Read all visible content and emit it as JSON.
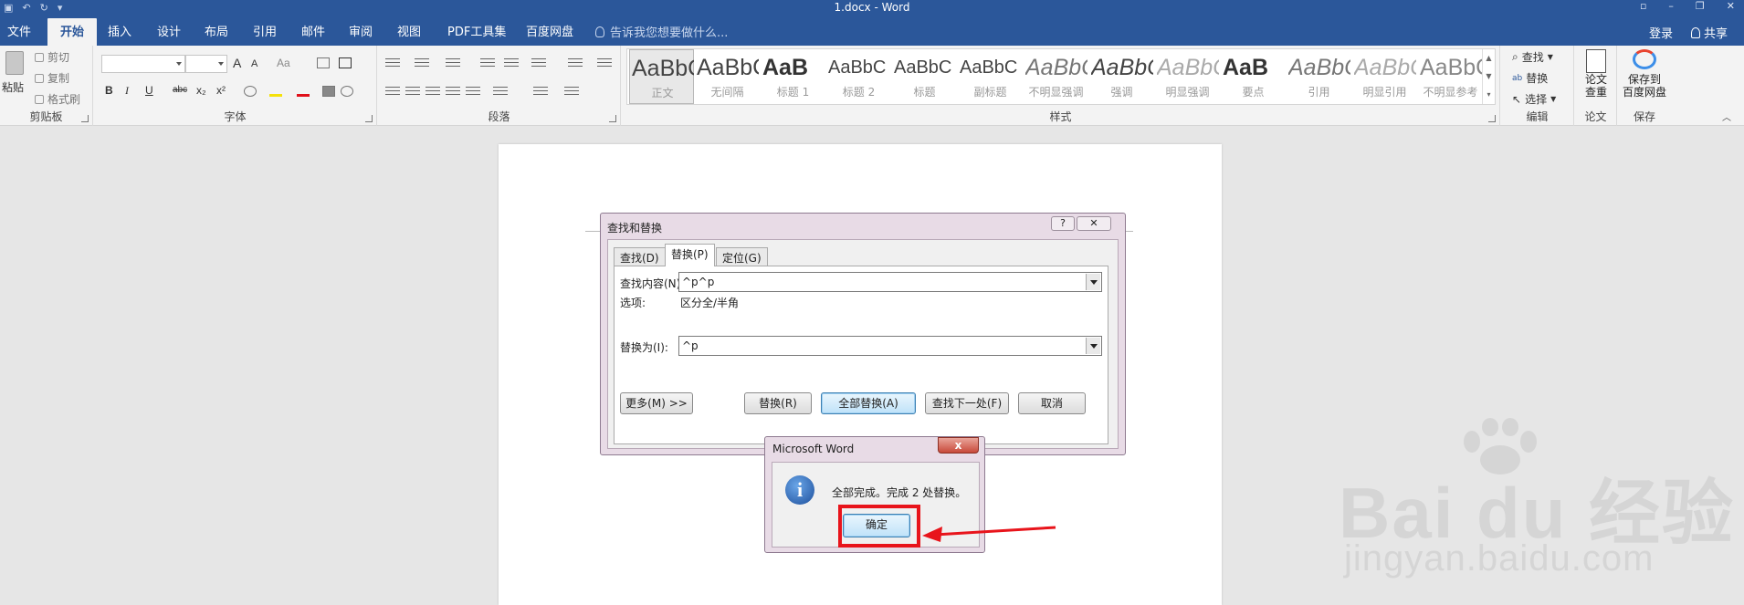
{
  "window": {
    "title": "1.docx - Word"
  },
  "tabs": [
    {
      "label": "文件"
    },
    {
      "label": "开始"
    },
    {
      "label": "插入"
    },
    {
      "label": "设计"
    },
    {
      "label": "布局"
    },
    {
      "label": "引用"
    },
    {
      "label": "邮件"
    },
    {
      "label": "审阅"
    },
    {
      "label": "视图"
    },
    {
      "label": "PDF工具集"
    },
    {
      "label": "百度网盘"
    }
  ],
  "tell_me": {
    "placeholder": "告诉我您想要做什么..."
  },
  "account": {
    "login": "登录",
    "share": "共享"
  },
  "ribbon": {
    "clipboard": {
      "paste": "粘贴",
      "cut": "剪切",
      "copy": "复制",
      "format_painter": "格式刷",
      "label": "剪贴板"
    },
    "font": {
      "label": "字体",
      "grow": "A",
      "shrink": "A",
      "change_case": "Aa",
      "bold": "B",
      "italic": "I",
      "underline": "U",
      "strike": "abc",
      "subscript": "x₂",
      "superscript": "x²"
    },
    "paragraph": {
      "label": "段落"
    },
    "styles": {
      "label": "样式",
      "items": [
        {
          "sample": "AaBbCcDd",
          "name": "正文"
        },
        {
          "sample": "AaBbCcDd",
          "name": "无间隔"
        },
        {
          "sample": "AaB",
          "name": "标题 1"
        },
        {
          "sample": "AaBbC",
          "name": "标题 2"
        },
        {
          "sample": "AaBbC",
          "name": "标题"
        },
        {
          "sample": "AaBbC",
          "name": "副标题"
        },
        {
          "sample": "AaBbCcDd",
          "name": "不明显强调"
        },
        {
          "sample": "AaBbCcDd",
          "name": "强调"
        },
        {
          "sample": "AaBbCcDd",
          "name": "明显强调"
        },
        {
          "sample": "AaB",
          "name": "要点"
        },
        {
          "sample": "AaBbCcDd",
          "name": "引用"
        },
        {
          "sample": "AaBbCcDd",
          "name": "明显引用"
        },
        {
          "sample": "AaBbCcDd",
          "name": "不明显参考"
        }
      ]
    },
    "editing": {
      "find": "查找",
      "replace": "替换",
      "select": "选择",
      "label": "编辑"
    },
    "paper": {
      "button_line1": "论文",
      "button_line2": "查重",
      "label": "论文"
    },
    "save": {
      "button_line1": "保存到",
      "button_line2": "百度网盘",
      "label": "保存"
    }
  },
  "find_replace_dialog": {
    "title": "查找和替换",
    "help_glyph": "?",
    "close_glyph": "✕",
    "tabs": [
      {
        "label": "查找(D)"
      },
      {
        "label": "替换(P)"
      },
      {
        "label": "定位(G)"
      }
    ],
    "find_label": "查找内容(N):",
    "find_value": "^p^p",
    "options_label": "选项:",
    "options_value": "区分全/半角",
    "replace_label": "替换为(I):",
    "replace_value": "^p",
    "buttons": {
      "more": "更多(M) >>",
      "replace": "替换(R)",
      "replace_all": "全部替换(A)",
      "find_next": "查找下一处(F)",
      "cancel": "取消"
    }
  },
  "message_box": {
    "title": "Microsoft Word",
    "icon_glyph": "i",
    "close_glyph": "x",
    "message": "全部完成。完成 2 处替换。",
    "ok": "确定"
  },
  "watermark": {
    "main": "Bai du 经验",
    "sub": "jingyan.baidu.com"
  },
  "colors": {
    "title_bar": "#2b579a",
    "highlight": "#e8141b",
    "ribbon": "#f3f3f3"
  }
}
